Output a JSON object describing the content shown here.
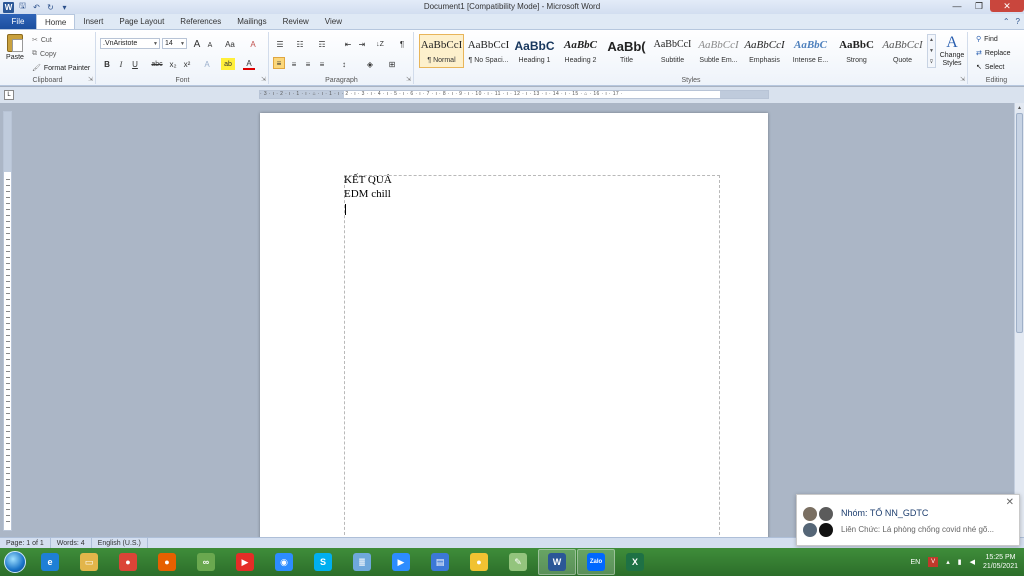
{
  "window": {
    "title": "Document1 [Compatibility Mode] - Microsoft Word",
    "minimize_glyph": "—",
    "maximize_glyph": "❐",
    "close_glyph": "✕"
  },
  "qat": {
    "logo_letter": "W",
    "save_glyph": "🖫",
    "undo_glyph": "↶",
    "redo_glyph": "↻",
    "customize_glyph": "▾"
  },
  "tabs": {
    "file": "File",
    "items": [
      "Home",
      "Insert",
      "Page Layout",
      "References",
      "Mailings",
      "Review",
      "View"
    ],
    "help_glyph": "?",
    "collapse_glyph": "⌃"
  },
  "clipboard": {
    "paste": "Paste",
    "cut": "Cut",
    "copy": "Copy",
    "format_painter": "Format Painter",
    "group_label": "Clipboard"
  },
  "font": {
    "name": ".VnAristote",
    "size": "14",
    "grow": "A",
    "shrink": "A",
    "change_case": "Aa",
    "clear": "A",
    "bold": "B",
    "italic": "I",
    "underline": "U",
    "strike": "abc",
    "subscript": "x₂",
    "superscript": "x²",
    "effects": "A",
    "highlight": "ab",
    "color": "A",
    "group_label": "Font"
  },
  "paragraph": {
    "group_label": "Paragraph",
    "bullets": "☰",
    "numbering": "☷",
    "multilevel": "☶",
    "decrease_indent": "⇤",
    "increase_indent": "⇥",
    "sort": "↓Z",
    "show_marks": "¶",
    "align_left": "≡",
    "align_center": "≡",
    "align_right": "≡",
    "justify": "≡",
    "line_spacing": "↕",
    "shading": "◈",
    "borders": "⊞"
  },
  "styles": {
    "group_label": "Styles",
    "items": [
      {
        "sample": "AaBbCcI",
        "name": "¶ Normal"
      },
      {
        "sample": "AaBbCcI",
        "name": "¶ No Spaci..."
      },
      {
        "sample": "AaBbC",
        "name": "Heading 1"
      },
      {
        "sample": "AaBbC",
        "name": "Heading 2"
      },
      {
        "sample": "AaBb(",
        "name": "Title"
      },
      {
        "sample": "AaBbCcI",
        "name": "Subtitle"
      },
      {
        "sample": "AaBbCcI",
        "name": "Subtle Em..."
      },
      {
        "sample": "AaBbCcI",
        "name": "Emphasis"
      },
      {
        "sample": "AaBbC",
        "name": "Intense E..."
      },
      {
        "sample": "AaBbC",
        "name": "Strong"
      },
      {
        "sample": "AaBbCcI",
        "name": "Quote"
      }
    ],
    "change_styles": "Change Styles",
    "change_styles_glyph": "A",
    "scroll_up": "▲",
    "scroll_down": "▼",
    "more": "⊽"
  },
  "editing": {
    "group_label": "Editing",
    "find": "Find",
    "replace": "Replace",
    "select": "Select"
  },
  "ruler": {
    "toggle_glyph": "L",
    "ticks": "· 3 · ı · 2 · ı · 1 · ı · ⌂ · ı · 1 · ı · 2 · ı · 3 · ı · 4 · ı · 5 · ı · 6 · ı · 7 · ı · 8 · ı · 9 · ı · 10 · ı · 11 · ı · 12 · ı · 13 · ı · 14 · ı · 15 · ⌂ · 16 · ı · 17 ·"
  },
  "document": {
    "lines": [
      "KẾT QUẢ",
      "EDM chill"
    ]
  },
  "scrollbar": {
    "up": "▲",
    "down": "▼"
  },
  "status": {
    "page": "Page: 1 of 1",
    "words": "Words: 4",
    "language": "English (U.S.)"
  },
  "notification": {
    "title": "Nhóm: TỔ NN_GDTC",
    "message": "Liên Chức: Lá phòng chống covid nhé gõ...",
    "close_glyph": "✕"
  },
  "taskbar": {
    "apps": [
      {
        "name": "internet-explorer",
        "glyph": "e",
        "color": "#1e7fd6"
      },
      {
        "name": "file-explorer",
        "glyph": "▭",
        "color": "#e2b54a"
      },
      {
        "name": "chrome",
        "glyph": "●",
        "color": "#db4437"
      },
      {
        "name": "firefox",
        "glyph": "●",
        "color": "#e66000"
      },
      {
        "name": "app-green",
        "glyph": "∞",
        "color": "#6aa84f"
      },
      {
        "name": "youtube",
        "glyph": "▶",
        "color": "#e52d27"
      },
      {
        "name": "zalo-meet",
        "glyph": "◉",
        "color": "#2d8cff"
      },
      {
        "name": "skype",
        "glyph": "S",
        "color": "#00aff0"
      },
      {
        "name": "notes",
        "glyph": "≣",
        "color": "#6fa8dc"
      },
      {
        "name": "zoom",
        "glyph": "▶",
        "color": "#2d8cff"
      },
      {
        "name": "network-app",
        "glyph": "▤",
        "color": "#3c78d8"
      },
      {
        "name": "colorful-app",
        "glyph": "●",
        "color": "#f1c232"
      },
      {
        "name": "paint",
        "glyph": "✎",
        "color": "#93c47d"
      },
      {
        "name": "word",
        "glyph": "W",
        "color": "#2b5797"
      },
      {
        "name": "zalo",
        "glyph": "Zalo",
        "color": "#0068ff"
      },
      {
        "name": "excel",
        "glyph": "X",
        "color": "#1e7145"
      }
    ],
    "language": "EN",
    "time": "15:25 PM",
    "date": "21/05/2021"
  }
}
